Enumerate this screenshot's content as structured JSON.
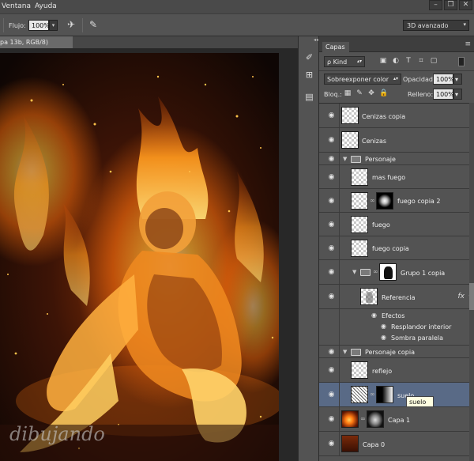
{
  "menu": {
    "items": [
      "Ventana",
      "Ayuda"
    ]
  },
  "window_controls": [
    "–",
    "❐",
    "✕"
  ],
  "options_bar": {
    "flow_label": "Flujo:",
    "flow_value": "100%",
    "workspace": "3D avanzado"
  },
  "document": {
    "tab_title": "pa 13b, RGB/8)"
  },
  "canvas": {
    "watermark": "dibujando"
  },
  "panel": {
    "tab": "Capas",
    "menu_icon": "≡",
    "kind_filter": "ρ Kind",
    "blend_mode": "Sobreexponer color",
    "opacity_label": "Opacidad:",
    "opacity_value": "100%",
    "lock_label": "Bloq.:",
    "fill_label": "Relleno:",
    "fill_value": "100%"
  },
  "layers": [
    {
      "name": "Cenizas copia",
      "type": "layer"
    },
    {
      "name": "Cenizas",
      "type": "layer"
    },
    {
      "name": "Personaje",
      "type": "group"
    },
    {
      "name": "mas fuego",
      "type": "layer"
    },
    {
      "name": "fuego copia 2",
      "type": "layer_mask"
    },
    {
      "name": "fuego",
      "type": "layer"
    },
    {
      "name": "fuego copia",
      "type": "layer"
    },
    {
      "name": "Grupo 1 copia",
      "type": "group_mask"
    },
    {
      "name": "Referencia",
      "type": "layer_fx"
    },
    {
      "name": "Efectos",
      "type": "effects"
    },
    {
      "name": "Resplandor interior",
      "type": "effect"
    },
    {
      "name": "Sombra paralela",
      "type": "effect"
    },
    {
      "name": "Personaje copia",
      "type": "group"
    },
    {
      "name": "reflejo",
      "type": "layer"
    },
    {
      "name": "suelo",
      "type": "layer_mask",
      "selected": true
    },
    {
      "name": "Capa 1",
      "type": "layer_mask"
    },
    {
      "name": "Capa 0",
      "type": "layer"
    }
  ],
  "tooltip": "suelo"
}
